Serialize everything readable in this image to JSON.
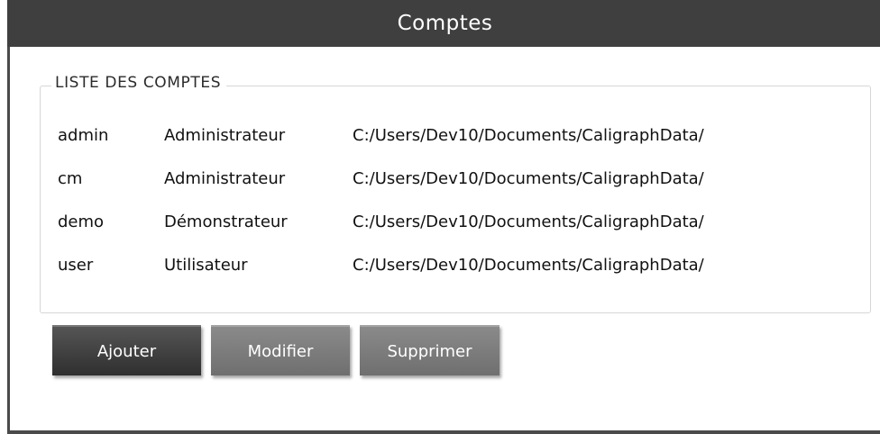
{
  "window": {
    "title": "Comptes"
  },
  "group": {
    "legend": "LISTE DES COMPTES"
  },
  "accounts": [
    {
      "name": "admin",
      "role": "Administrateur",
      "path": "C:/Users/Dev10/Documents/CaligraphData/"
    },
    {
      "name": "cm",
      "role": "Administrateur",
      "path": "C:/Users/Dev10/Documents/CaligraphData/"
    },
    {
      "name": "demo",
      "role": "Démonstrateur",
      "path": "C:/Users/Dev10/Documents/CaligraphData/"
    },
    {
      "name": "user",
      "role": "Utilisateur",
      "path": "C:/Users/Dev10/Documents/CaligraphData/"
    }
  ],
  "buttons": {
    "add": "Ajouter",
    "edit": "Modifier",
    "delete": "Supprimer"
  },
  "colors": {
    "titlebar": "#3f3f3f",
    "primary_button": "#3f3f3f",
    "secondary_button": "#7d7d7d"
  }
}
